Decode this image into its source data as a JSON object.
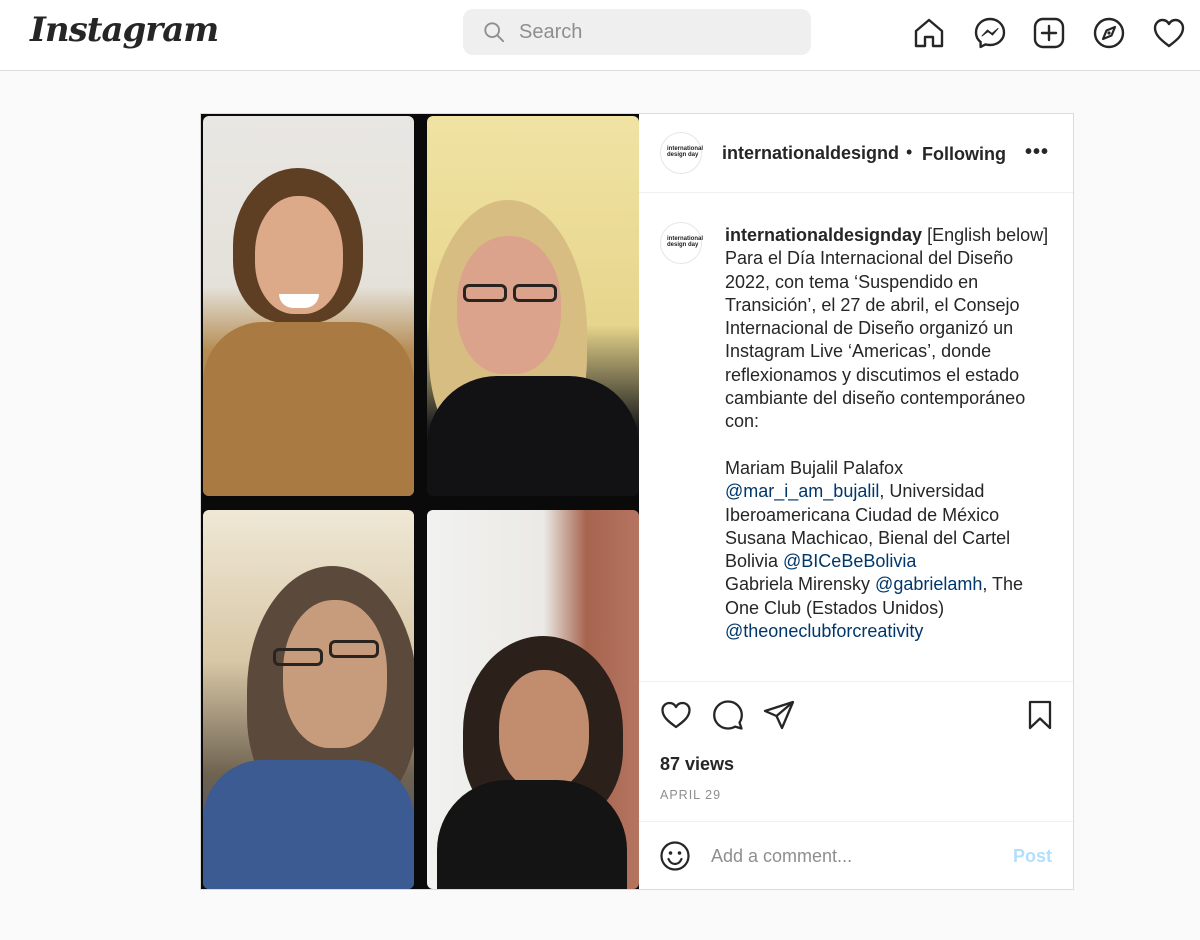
{
  "header": {
    "logo": "Instagram",
    "search_placeholder": "Search",
    "nav_icons": [
      "home-icon",
      "messenger-icon",
      "new-post-icon",
      "explore-icon",
      "activity-heart-icon"
    ]
  },
  "post": {
    "header": {
      "avatar_text": "international design day",
      "username": "internationaldesignd",
      "separator": "•",
      "follow_status": "Following",
      "more": "•••"
    },
    "caption": {
      "username": "internationaldesignday",
      "p1": "[English below]",
      "p2": "Para el Día Internacional del Diseño 2022, con tema ‘Suspendido en Transición’, el 27 de abril, el Consejo Internacional de Diseño organizó un Instagram Live ‘Americas’, donde reflexionamos y discutimos el estado cambiante del diseño contemporáneo con:",
      "l1": "Mariam Bujalil Palafox",
      "m1": "@mar_i_am_bujalil",
      "l2": ", Universidad Iberoamericana Ciudad de México",
      "l3": "Susana Machicao, Bienal del Cartel Bolivia ",
      "m2": "@BICeBeBolivia",
      "l4": "Gabriela Mirensky ",
      "m3": "@gabrielamh",
      "l5": ", The One Club (Estados Unidos)",
      "m4": "@theoneclubforcreativity"
    },
    "actions": {
      "icons": [
        "like-heart-icon",
        "comment-icon",
        "share-icon",
        "save-bookmark-icon"
      ]
    },
    "views": "87 views",
    "date": "APRIL 29",
    "comment": {
      "placeholder": "Add a comment...",
      "post_label": "Post"
    }
  },
  "colors": {
    "link": "#00376b",
    "post_button_disabled": "#b2dffc",
    "muted": "#8e8e8e",
    "border": "#dbdbdb"
  }
}
